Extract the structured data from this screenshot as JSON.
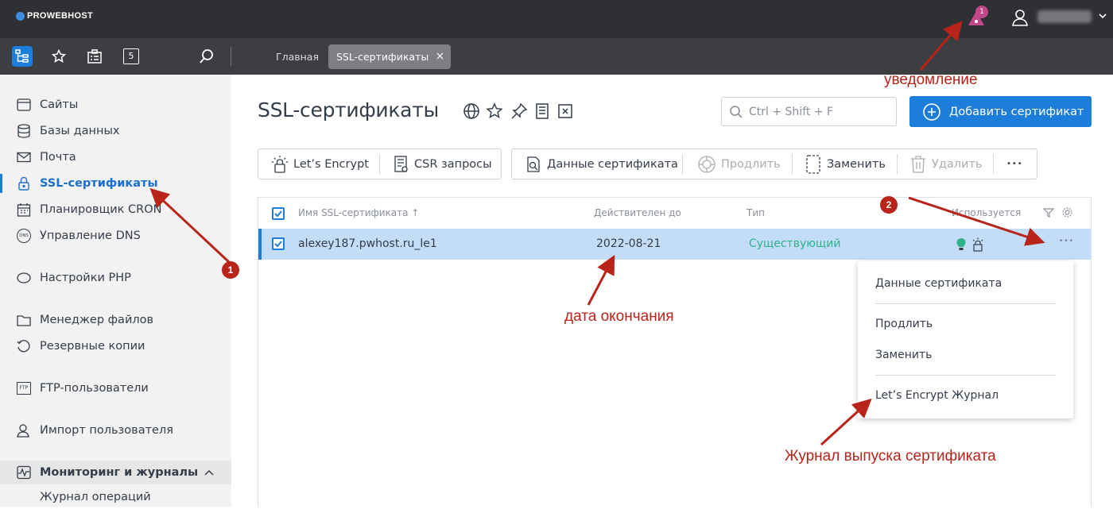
{
  "topbar": {
    "logo_text": "PROWEBHOST",
    "notification_count": "1",
    "user_name": "host1877"
  },
  "tabs": {
    "home_label": "Главная",
    "ssl_label": "SSL-сертификаты",
    "close_glyph": "×",
    "calendar_icon_text": "5"
  },
  "sidebar": {
    "items": [
      {
        "label": "Сайты",
        "icon": "globe-icon"
      },
      {
        "label": "Базы данных",
        "icon": "database-icon"
      },
      {
        "label": "Почта",
        "icon": "mail-icon"
      },
      {
        "label": "SSL-сертификаты",
        "icon": "lock-icon"
      },
      {
        "label": "Планировщик CRON",
        "icon": "calendar-icon"
      },
      {
        "label": "Управление DNS",
        "icon": "dns-icon"
      },
      {
        "label": "Настройки PHP",
        "icon": "php-icon"
      },
      {
        "label": "Менеджер файлов",
        "icon": "folder-icon"
      },
      {
        "label": "Резервные копии",
        "icon": "backup-icon"
      },
      {
        "label": "FTP-пользователи",
        "icon": "ftp-icon"
      },
      {
        "label": "Импорт пользователя",
        "icon": "import-user-icon"
      },
      {
        "label": "Мониторинг и журналы",
        "icon": "monitoring-icon"
      },
      {
        "label": "Журнал операций",
        "icon": ""
      }
    ],
    "dns_icon_text": "DNS",
    "ftp_icon_text": "FTP"
  },
  "main": {
    "title": "SSL-сертификаты",
    "search_placeholder": "Ctrl + Shift + F",
    "add_button": "Добавить сертификат",
    "more_glyph": "•••"
  },
  "toolbar": {
    "letsencrypt": "Let’s Encrypt",
    "csr": "CSR запросы",
    "cert_data": "Данные сертификата",
    "renew": "Продлить",
    "replace": "Заменить",
    "delete": "Удалить"
  },
  "table": {
    "headers": {
      "name": "Имя SSL-сертификата ↑",
      "valid_until": "Действителен до",
      "type": "Тип",
      "used": "Используется"
    },
    "rows": [
      {
        "name": "alexey187.pwhost.ru_le1",
        "valid_until": "2022-08-21",
        "type": "Существующий"
      }
    ],
    "type_color": "#2db38a",
    "row_more_glyph": "•••"
  },
  "context_menu": {
    "items": [
      "Данные сертификата",
      "Продлить",
      "Заменить",
      "Let’s Encrypt Журнал"
    ]
  },
  "annotations": {
    "notification": "уведомление",
    "end_date": "дата окончания",
    "journal": "Журнал выпуска сертификата",
    "badge1": "1",
    "badge2": "2"
  },
  "colors": {
    "accent": "#1c7ddb",
    "annotation": "#b8231a",
    "notification_badge": "#c24789"
  }
}
